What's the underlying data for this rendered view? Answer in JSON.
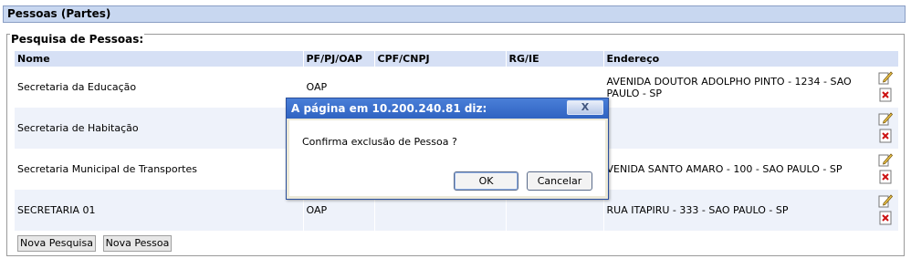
{
  "header": {
    "title": "Pessoas (Partes)"
  },
  "search": {
    "legend": "Pesquisa de Pessoas:"
  },
  "table": {
    "columns": [
      "Nome",
      "PF/PJ/OAP",
      "CPF/CNPJ",
      "RG/IE",
      "Endereço"
    ],
    "rows": [
      {
        "nome": "Secretaria da Educação",
        "tipo": "OAP",
        "cpf": "",
        "rg": "",
        "endereco": "AVENIDA DOUTOR ADOLPHO PINTO - 1234 - SAO PAULO - SP"
      },
      {
        "nome": "Secretaria de Habitação",
        "tipo": "",
        "cpf": "",
        "rg": "",
        "endereco": ""
      },
      {
        "nome": "Secretaria Municipal de Transportes",
        "tipo": "",
        "cpf": "",
        "rg": "",
        "endereco": "VENIDA SANTO AMARO - 100 - SAO PAULO - SP"
      },
      {
        "nome": "SECRETARIA 01",
        "tipo": "OAP",
        "cpf": "",
        "rg": "",
        "endereco": "RUA ITAPIRU - 333 - SAO PAULO - SP"
      }
    ],
    "icons": {
      "edit": "edit-pencil-icon",
      "delete": "delete-x-icon"
    }
  },
  "buttons": {
    "new_search": "Nova Pesquisa",
    "new_person": "Nova Pessoa"
  },
  "dialog": {
    "title": "A página em 10.200.240.81 diz:",
    "close": "X",
    "message": "Confirma exclusão de Pessoa ?",
    "ok": "OK",
    "cancel": "Cancelar"
  },
  "colors": {
    "header_bg": "#c8d7f0",
    "table_header_bg": "#d6e0f5",
    "dialog_title": "#2f63c2"
  }
}
